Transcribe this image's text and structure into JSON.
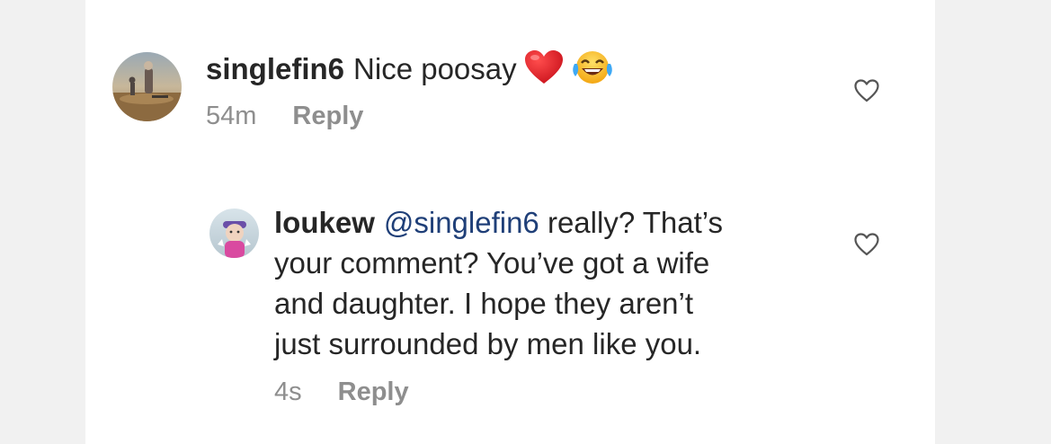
{
  "comments": [
    {
      "username": "singlefin6",
      "text": "Nice poosay",
      "emojis": [
        "red-heart-emoji",
        "tears-of-joy-emoji"
      ],
      "time": "54m",
      "reply_label": "Reply",
      "avatar_icon": "profile-photo-desert-figures",
      "like_icon": "heart-outline-icon"
    },
    {
      "username": "loukew",
      "mention": "@singlefin6",
      "text_line1": " really? That’s",
      "text_line2": "your comment? You’ve got a wife",
      "text_line3": "and daughter. I hope they aren’t",
      "text_line4": "just surrounded by men like you.",
      "time": "4s",
      "reply_label": "Reply",
      "avatar_icon": "profile-photo-bitmoji",
      "like_icon": "heart-outline-icon"
    }
  ],
  "colors": {
    "text": "#262626",
    "secondary": "#8e8e8e",
    "mention": "#1f3f78",
    "side_background": "#f1f1f1"
  }
}
